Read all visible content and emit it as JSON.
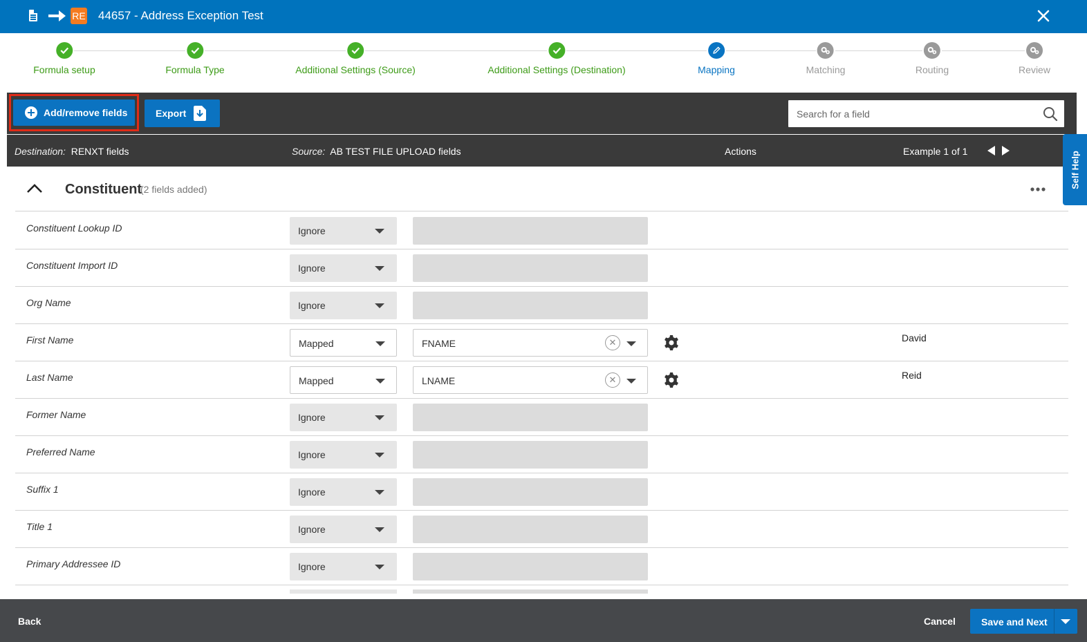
{
  "window": {
    "title": "44657 - Address Exception Test",
    "app_badge": "RE",
    "icons": [
      "document-icon",
      "arrow-right-icon",
      "re-badge-icon",
      "close-icon"
    ]
  },
  "stepper": [
    {
      "label": "Formula setup",
      "state": "done"
    },
    {
      "label": "Formula Type",
      "state": "done"
    },
    {
      "label": "Additional Settings (Source)",
      "state": "done"
    },
    {
      "label": "Additional Settings (Destination)",
      "state": "done"
    },
    {
      "label": "Mapping",
      "state": "current"
    },
    {
      "label": "Matching",
      "state": "todo"
    },
    {
      "label": "Routing",
      "state": "todo"
    },
    {
      "label": "Review",
      "state": "todo"
    }
  ],
  "toolbar": {
    "add_label": "Add/remove fields",
    "export_label": "Export",
    "search_placeholder": "Search for a field"
  },
  "columns": {
    "destination_label": "Destination:",
    "destination_value": "RENXT fields",
    "source_label": "Source:",
    "source_value": "AB TEST FILE UPLOAD fields",
    "actions": "Actions",
    "example": "Example 1 of 1"
  },
  "self_help": "Self Help",
  "section": {
    "name": "Constituent",
    "count": "(2 fields added)"
  },
  "rows": [
    {
      "field": "Constituent Lookup ID",
      "mode": "Ignore",
      "source": "",
      "example": ""
    },
    {
      "field": "Constituent Import ID",
      "mode": "Ignore",
      "source": "",
      "example": ""
    },
    {
      "field": "Org Name",
      "mode": "Ignore",
      "source": "",
      "example": ""
    },
    {
      "field": "First Name",
      "mode": "Mapped",
      "source": "FNAME",
      "example": "David"
    },
    {
      "field": "Last Name",
      "mode": "Mapped",
      "source": "LNAME",
      "example": "Reid"
    },
    {
      "field": "Former Name",
      "mode": "Ignore",
      "source": "",
      "example": ""
    },
    {
      "field": "Preferred Name",
      "mode": "Ignore",
      "source": "",
      "example": ""
    },
    {
      "field": "Suffix 1",
      "mode": "Ignore",
      "source": "",
      "example": ""
    },
    {
      "field": "Title 1",
      "mode": "Ignore",
      "source": "",
      "example": ""
    },
    {
      "field": "Primary Addressee ID",
      "mode": "Ignore",
      "source": "",
      "example": ""
    }
  ],
  "footer": {
    "back": "Back",
    "cancel": "Cancel",
    "save_next": "Save and Next"
  },
  "colors": {
    "brand_blue": "#0073bd",
    "button_blue": "#0b73c1",
    "done_green": "#45b028",
    "toolbar_dark": "#3a3a3a",
    "highlight_red": "#e02b17"
  }
}
